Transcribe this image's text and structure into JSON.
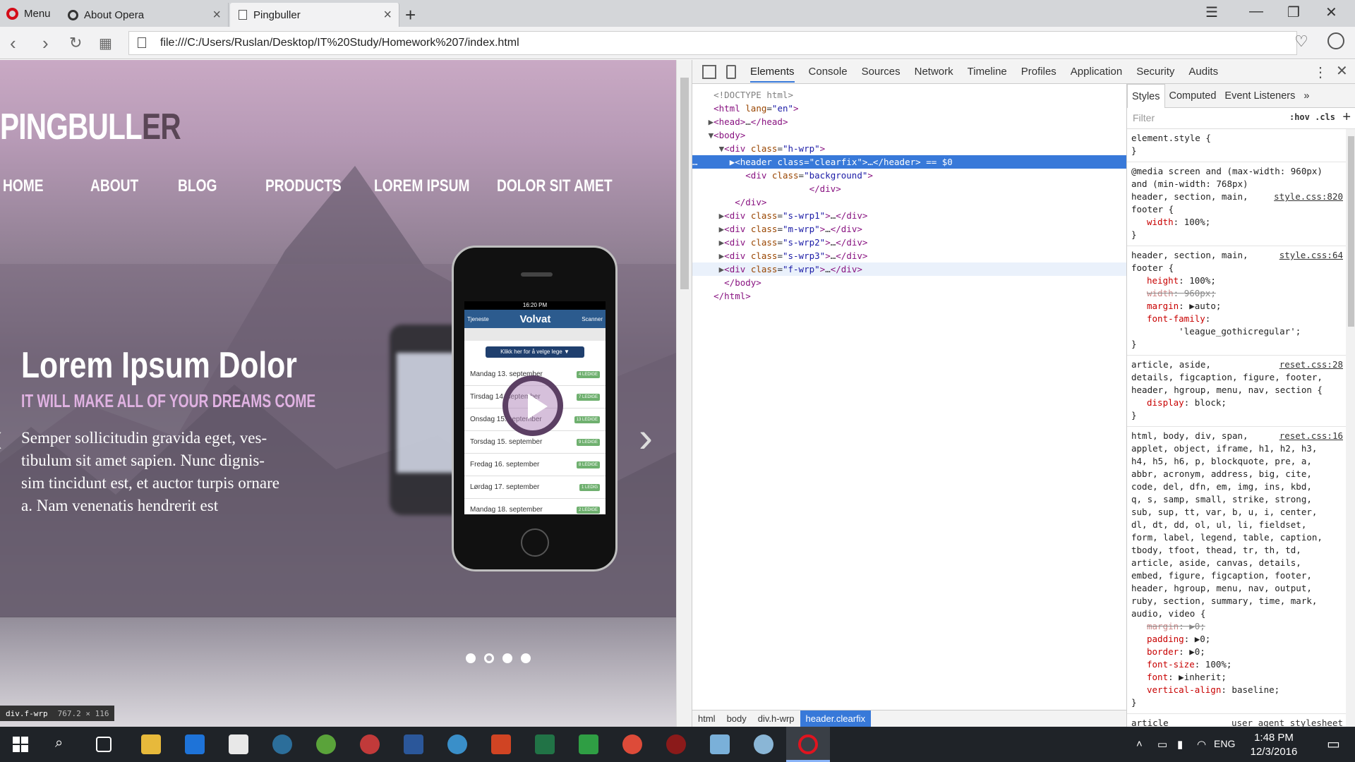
{
  "browser": {
    "menu_label": "Menu",
    "tabs": [
      {
        "title": "About Opera",
        "icon": "opera-icon"
      },
      {
        "title": "Pingbuller",
        "icon": "page-icon",
        "active": true
      }
    ],
    "new_tab": "+",
    "url": "file:///C:/Users/Ruslan/Desktop/IT%20Study/Homework%207/index.html"
  },
  "page": {
    "logo_light": "PINGBULL",
    "logo_dark": "ER",
    "nav": [
      "HOME",
      "ABOUT",
      "BLOG",
      "PRODUCTS",
      "LOREM IPSUM",
      "DOLOR SIT AMET"
    ],
    "slide_title": "Lorem Ipsum Dolor",
    "slide_subtitle": "IT WILL MAKE ALL OF YOUR DREAMS COME",
    "slide_text": "Semper sollicitudin gravida eget, ves-tibulum sit amet sapien. Nunc dignis-sim tincidunt est, et auctor turpis ornare a. Nam venenatis hendrerit est",
    "phone_screen": {
      "time": "16:20 PM",
      "left_btn": "Tjeneste",
      "brand": "Volvat",
      "right_btn": "Scanner",
      "select_btn": "Klikk her for å velge lege ▼",
      "days": [
        {
          "day": "Mandag 13. september",
          "tag": "4 LEDIGE"
        },
        {
          "day": "Tirsdag 14. september",
          "tag": "7 LEDIGE"
        },
        {
          "day": "Onsdag 15. september",
          "tag": "13 LEDIGE"
        },
        {
          "day": "Torsdag 15. september",
          "tag": "9 LEDIGE"
        },
        {
          "day": "Fredag 16. september",
          "tag": "8 LEDIGE"
        },
        {
          "day": "Lørdag 17. september",
          "tag": "1 LEDIG"
        },
        {
          "day": "Mandag 18. september",
          "tag": "2 LEDIGE"
        }
      ]
    },
    "slide_count": 4,
    "active_slide": 2,
    "hover_tip_selector": "div.f-wrp",
    "hover_tip_size": "767.2 × 116"
  },
  "devtools": {
    "tabs": [
      "Elements",
      "Console",
      "Sources",
      "Network",
      "Timeline",
      "Profiles",
      "Application",
      "Security",
      "Audits"
    ],
    "active_tab": "Elements",
    "breadcrumbs": [
      "html",
      "body",
      "div.h-wrp",
      "header.clearfix"
    ],
    "styles_tabs": [
      "Styles",
      "Computed",
      "Event Listeners"
    ],
    "filter_placeholder": "Filter",
    "filter_toggles": ":hov .cls",
    "rules": [
      {
        "selector": "element.style {",
        "source": "",
        "props": [],
        "close": "}"
      },
      {
        "selector": "@media screen and (max-width: 960px) and (min-width: 768px)\nheader, section, main,\nfooter {",
        "source": "style.css:820",
        "props": [
          {
            "k": "width",
            "v": "100%;",
            "strike": false
          }
        ],
        "close": "}"
      },
      {
        "selector": "header, section, main,\nfooter {",
        "source": "style.css:64",
        "props": [
          {
            "k": "height",
            "v": "100%;",
            "strike": false
          },
          {
            "k": "width",
            "v": "960px;",
            "strike": true
          },
          {
            "k": "margin",
            "v": "▶auto;",
            "strike": false
          },
          {
            "k": "font-family",
            "v": "\n      'league_gothicregular';",
            "strike": false
          }
        ],
        "close": "}"
      },
      {
        "selector": "article, aside,\ndetails, figcaption, figure, footer,\nheader, hgroup, menu, nav, section {",
        "source": "reset.css:28",
        "props": [
          {
            "k": "display",
            "v": "block;",
            "strike": false
          }
        ],
        "close": "}"
      },
      {
        "selector": "html, body, div, span,\napplet, object, iframe, h1, h2, h3,\nh4, h5, h6, p, blockquote, pre, a,\nabbr, acronym, address, big, cite,\ncode, del, dfn, em, img, ins, kbd,\nq, s, samp, small, strike, strong,\nsub, sup, tt, var, b, u, i, center,\ndl, dt, dd, ol, ul, li, fieldset,\nform, label, legend, table, caption,\ntbody, tfoot, thead, tr, th, td,\narticle, aside, canvas, details,\nembed, figure, figcaption, footer,\nheader, hgroup, menu, nav, output,\nruby, section, summary, time, mark,\naudio, video {",
        "source": "reset.css:16",
        "props": [
          {
            "k": "margin",
            "v": "▶0;",
            "strike": true
          },
          {
            "k": "padding",
            "v": "▶0;",
            "strike": false
          },
          {
            "k": "border",
            "v": "▶0;",
            "strike": false
          },
          {
            "k": "font-size",
            "v": "100%;",
            "strike": false
          },
          {
            "k": "font",
            "v": "▶inherit;",
            "strike": false
          },
          {
            "k": "vertical-align",
            "v": "baseline;",
            "strike": false
          }
        ],
        "close": "}"
      },
      {
        "selector": "article",
        "source": "user agent stylesheet",
        "props": [],
        "close": ""
      }
    ]
  },
  "taskbar": {
    "lang": "ENG",
    "time": "1:48 PM",
    "date": "12/3/2016"
  }
}
